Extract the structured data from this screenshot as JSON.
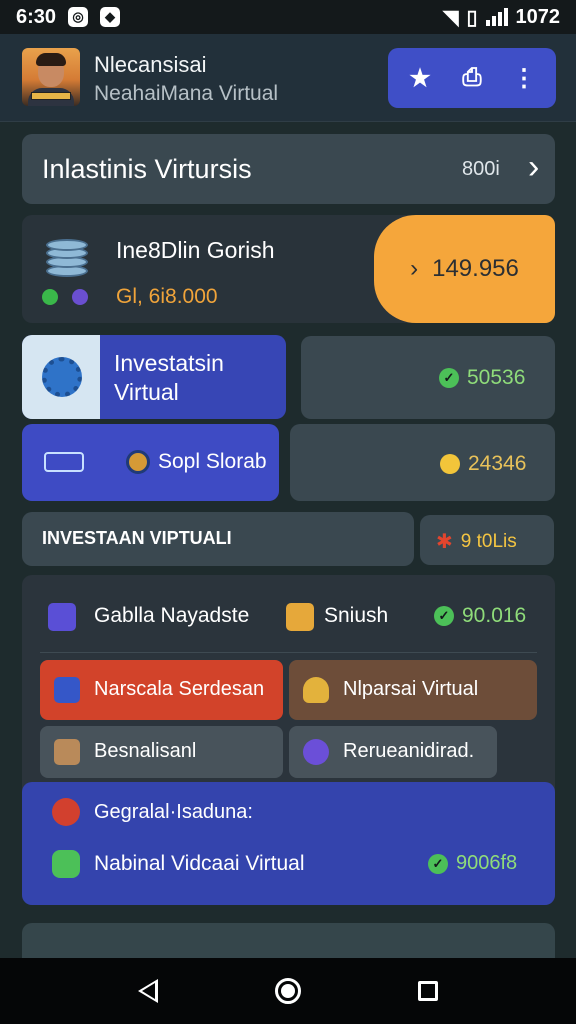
{
  "status_bar": {
    "time": "6:30",
    "right_text": "1072"
  },
  "header": {
    "user_name": "Nlecansisai",
    "user_sub": "NeahaiMana Virtual",
    "actions": [
      {
        "icon": "star-icon",
        "glyph": "★"
      },
      {
        "icon": "share-icon",
        "glyph": "⎙"
      },
      {
        "icon": "more-vert-icon",
        "glyph": "⋮"
      }
    ]
  },
  "title_card": {
    "title": "Inlastinis Virtursis",
    "count": "800i",
    "arrow": "›"
  },
  "balance": {
    "title": "Ine8Dlin Gorish",
    "subtitle": "Gl, 6i8.000",
    "pill_arrow": "›",
    "pill_value": "149.956"
  },
  "tiles": {
    "invest": {
      "label_line1": "Investatsin",
      "label_line2": "Virtual"
    },
    "invest_value": "50536",
    "spot": {
      "label": "Sopl Slorab"
    },
    "spot_value": "24346"
  },
  "section": {
    "title": "INVESTAAN VIPTUALI",
    "count": "9 t0Lis",
    "star": "✱"
  },
  "panel": {
    "row": {
      "left_label": "Gablla Nayadste",
      "mid_label": "Sniush",
      "value": "90.016"
    },
    "buttons": [
      {
        "label": "Narscala Serdesan"
      },
      {
        "label": "Nlparsai Virtual"
      },
      {
        "label": "Besnalisanl"
      },
      {
        "label": "Rerueanidirad."
      }
    ],
    "sub": {
      "row1": "Gegralal·Isaduna:",
      "row2": "Nabinal Vidcaai Virtual",
      "value": "9006f8"
    }
  },
  "colors": {
    "accent_blue": "#3e4bc4",
    "accent_orange": "#f5a63b",
    "positive_green": "#8fdc7a",
    "alert_red": "#d2432a"
  }
}
